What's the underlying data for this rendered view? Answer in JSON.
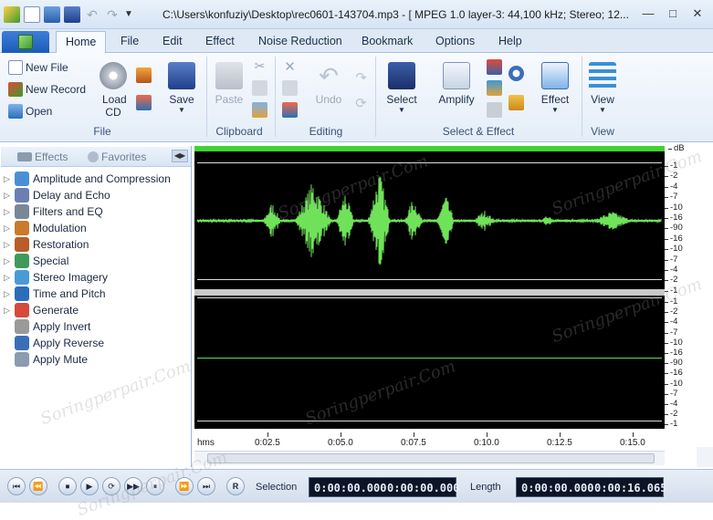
{
  "window": {
    "title": "C:\\Users\\konfuziy\\Desktop\\rec0601-143704.mp3 - [ MPEG 1.0 layer-3: 44,100 kHz; Stereo; 12...",
    "min_glyph": "—",
    "max_glyph": "□",
    "close_glyph": "✕"
  },
  "menu_tabs": [
    "Home",
    "File",
    "Edit",
    "Effect",
    "Noise Reduction",
    "Bookmark",
    "Options",
    "Help"
  ],
  "ribbon": {
    "file_group": {
      "label": "File",
      "new_file": "New File",
      "new_record": "New Record",
      "open": "Open",
      "load_cd": "Load CD",
      "save": "Save"
    },
    "clipboard_group": {
      "label": "Clipboard",
      "paste": "Paste"
    },
    "editing_group": {
      "label": "Editing",
      "undo": "Undo"
    },
    "select_effect_group": {
      "label": "Select & Effect",
      "select": "Select",
      "amplify": "Amplify",
      "effect": "Effect"
    },
    "view_group": {
      "label": "View",
      "view": "View"
    }
  },
  "panel": {
    "tab_effects": "Effects",
    "tab_favorites": "Favorites",
    "tree": [
      {
        "label": "Amplitude and Compression",
        "expandable": true,
        "color": "#4a8fd6"
      },
      {
        "label": "Delay and Echo",
        "expandable": true,
        "color": "#6b7fb3"
      },
      {
        "label": "Filters and EQ",
        "expandable": true,
        "color": "#7a8796"
      },
      {
        "label": "Modulation",
        "expandable": true,
        "color": "#c97a2a"
      },
      {
        "label": "Restoration",
        "expandable": true,
        "color": "#b85c2a"
      },
      {
        "label": "Special",
        "expandable": true,
        "color": "#3f9a5a"
      },
      {
        "label": "Stereo Imagery",
        "expandable": true,
        "color": "#4a9ad6"
      },
      {
        "label": "Time and Pitch",
        "expandable": true,
        "color": "#2a6fb8"
      },
      {
        "label": "Generate",
        "expandable": true,
        "color": "#d64a3a"
      },
      {
        "label": "Apply Invert",
        "expandable": false,
        "color": "#9a9a9a"
      },
      {
        "label": "Apply Reverse",
        "expandable": false,
        "color": "#3a6fb8"
      },
      {
        "label": "Apply Mute",
        "expandable": false,
        "color": "#8b9bb0"
      }
    ]
  },
  "db_scale": {
    "unit": "dB",
    "ch1": [
      "-1",
      "-2",
      "-4",
      "-7",
      "-10",
      "-16",
      "-90",
      "-16",
      "-10",
      "-7",
      "-4",
      "-2",
      "-1"
    ],
    "ch2": [
      "-1",
      "-2",
      "-4",
      "-7",
      "-10",
      "-16",
      "-90",
      "-16",
      "-10",
      "-7",
      "-4",
      "-2",
      "-1"
    ]
  },
  "time_axis": {
    "unit": "hms",
    "labels": [
      "0:02.5",
      "0:05.0",
      "0:07.5",
      "0:10.0",
      "0:12.5",
      "0:15.0"
    ]
  },
  "waveform": {
    "color": "#6fe25a",
    "overview_color": "#41d233"
  },
  "transport": {
    "buttons": [
      "⏮",
      "⏪",
      "⏹",
      "▶",
      "⟳",
      "▶▶",
      "⏸",
      "⏩",
      "⏭",
      "R"
    ],
    "selection_label": "Selection",
    "selection_start": "0:00:00.000",
    "selection_end": "0:00:00.000",
    "length_label": "Length",
    "length_start": "0:00:00.000",
    "length_end": "0:00:16.065"
  },
  "watermark": "Soringperpair.Com"
}
